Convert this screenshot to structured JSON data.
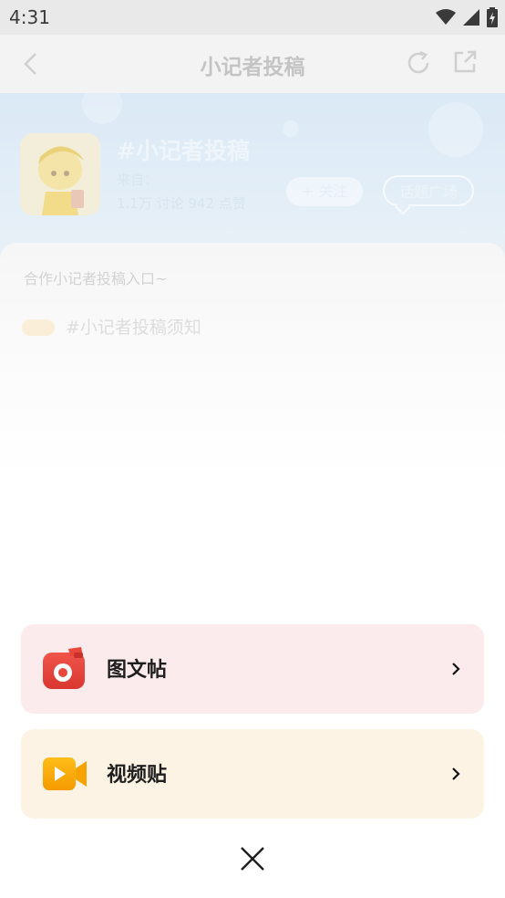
{
  "status_bar": {
    "time": "4:31",
    "icons": [
      "wifi-icon",
      "signal-icon",
      "battery-charging-icon"
    ]
  },
  "background_page": {
    "title": "小记者投稿",
    "nav_icons": [
      "back-icon",
      "refresh-icon",
      "share-icon"
    ],
    "topic": {
      "name": "#小记者投稿",
      "from_label": "来自：",
      "stats": "1.1万 讨论   942 点赞",
      "follow_label": "+ 关注",
      "square_label": "话题广场"
    },
    "description": "合作小记者投稿入口~",
    "pinned_tag": "",
    "pinned_post": "#小记者投稿须知"
  },
  "sheet": {
    "options": [
      {
        "label": "图文帖",
        "icon": "camera-icon",
        "background": "#fcebed"
      },
      {
        "label": "视频贴",
        "icon": "video-camera-icon",
        "background": "#fdf3e5"
      }
    ],
    "close_icon": "close-icon"
  },
  "colors": {
    "header_gradient": "#dbe9f6",
    "camera_icon": "#e8473c",
    "video_icon": "#f6a300"
  }
}
